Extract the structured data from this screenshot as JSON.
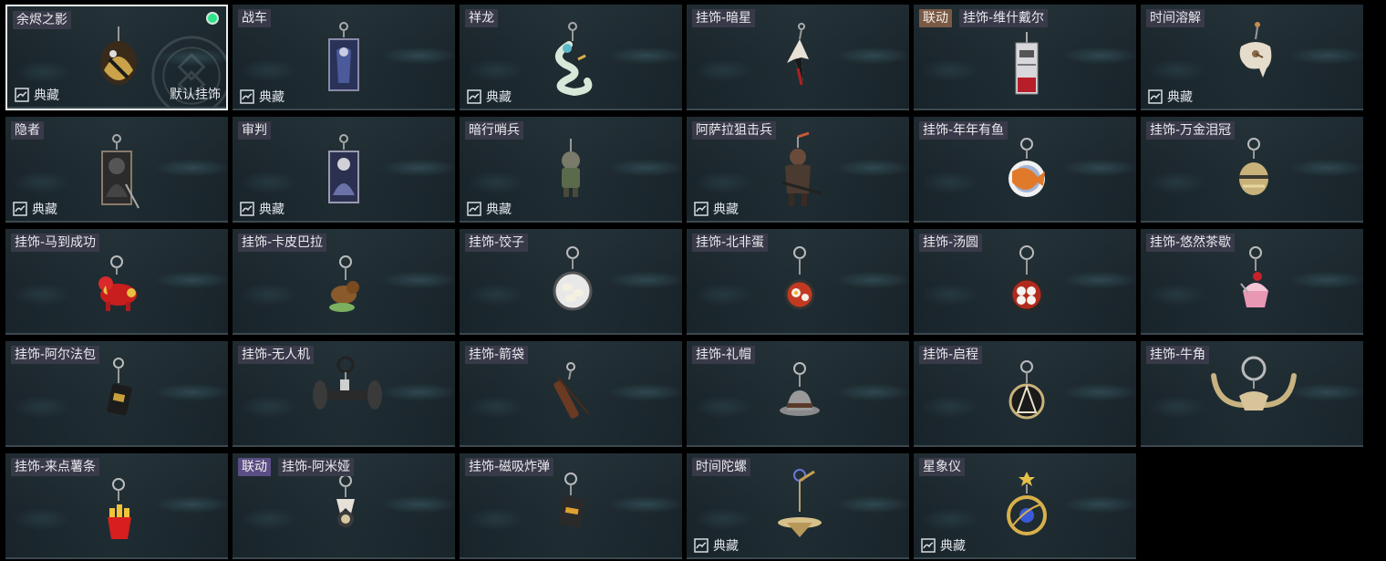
{
  "cards": [
    {
      "id": "c1",
      "label": "余烬之影",
      "rarity": "典藏",
      "default_text": "默认挂饰",
      "equipped": true,
      "charm": "ember-shadow-charm"
    },
    {
      "id": "c2",
      "label": "战车",
      "rarity": "典藏",
      "charm": "chariot-card-charm"
    },
    {
      "id": "c3",
      "label": "祥龙",
      "rarity": "典藏",
      "charm": "dragon-charm"
    },
    {
      "id": "c4",
      "label": "挂饰-暗星",
      "charm": "dark-star-charm"
    },
    {
      "id": "c5",
      "collab": "联动",
      "label": "挂饰-维什戴尔",
      "charm": "wisadel-charm"
    },
    {
      "id": "c6",
      "label": "时间溶解",
      "rarity": "典藏",
      "charm": "melting-clock-charm"
    },
    {
      "id": "c7",
      "label": "隐者",
      "rarity": "典藏",
      "charm": "hermit-card-charm"
    },
    {
      "id": "c8",
      "label": "审判",
      "rarity": "典藏",
      "charm": "judgement-card-charm"
    },
    {
      "id": "c9",
      "label": "暗行哨兵",
      "rarity": "典藏",
      "charm": "sentry-charm"
    },
    {
      "id": "c10",
      "label": "阿萨拉狙击兵",
      "rarity": "典藏",
      "charm": "sniper-charm"
    },
    {
      "id": "c11",
      "label": "挂饰-年年有鱼",
      "charm": "fish-plate-charm"
    },
    {
      "id": "c12",
      "label": "挂饰-万金泪冠",
      "charm": "gold-crown-charm"
    },
    {
      "id": "c13",
      "label": "挂饰-马到成功",
      "charm": "horse-charm"
    },
    {
      "id": "c14",
      "label": "挂饰-卡皮巴拉",
      "charm": "capybara-charm"
    },
    {
      "id": "c15",
      "label": "挂饰-饺子",
      "charm": "dumpling-charm"
    },
    {
      "id": "c16",
      "label": "挂饰-北非蛋",
      "charm": "shakshuka-charm"
    },
    {
      "id": "c17",
      "label": "挂饰-汤圆",
      "charm": "tangyuan-charm"
    },
    {
      "id": "c18",
      "label": "挂饰-悠然茶歇",
      "charm": "cupcake-charm"
    },
    {
      "id": "c19",
      "label": "挂饰-阿尔法包",
      "charm": "alpha-pack-charm"
    },
    {
      "id": "c20",
      "label": "挂饰-无人机",
      "charm": "drone-charm"
    },
    {
      "id": "c21",
      "label": "挂饰-箭袋",
      "charm": "quiver-charm"
    },
    {
      "id": "c22",
      "label": "挂饰-礼帽",
      "charm": "top-hat-charm"
    },
    {
      "id": "c23",
      "label": "挂饰-启程",
      "charm": "compass-charm"
    },
    {
      "id": "c24",
      "label": "挂饰-牛角",
      "charm": "bull-horn-charm"
    },
    {
      "id": "c25",
      "label": "挂饰-来点薯条",
      "charm": "fries-charm"
    },
    {
      "id": "c26",
      "collab": "联动",
      "label": "挂饰-阿米娅",
      "charm": "amiya-charm"
    },
    {
      "id": "c27",
      "label": "挂饰-磁吸炸弹",
      "charm": "sticky-bomb-charm"
    },
    {
      "id": "c28",
      "label": "时间陀螺",
      "rarity": "典藏",
      "charm": "spinning-top-charm"
    },
    {
      "id": "c29",
      "label": "星象仪",
      "rarity": "典藏",
      "charm": "astrolabe-charm"
    }
  ],
  "colors": {
    "selected_border": "#e8eef0",
    "equipped_dot": "#2ee38a",
    "name_tag_bg": "#3c3c4b",
    "collab_brown": "#7a5a45",
    "collab_purple": "#5b4d86"
  }
}
